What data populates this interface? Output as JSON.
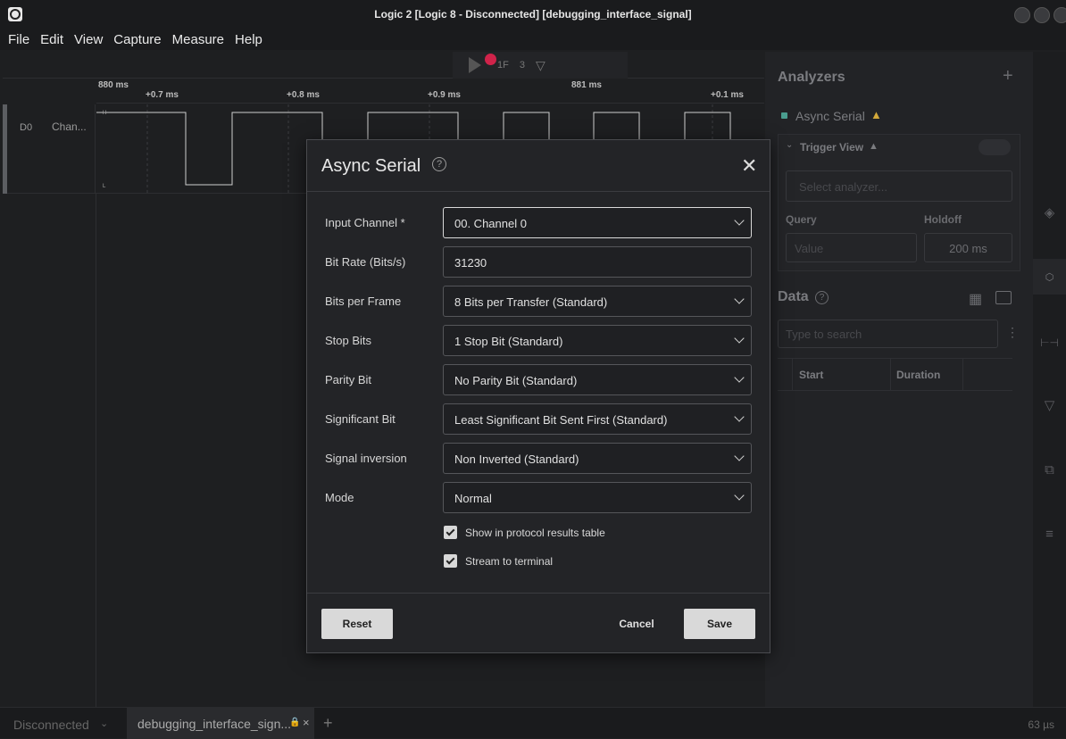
{
  "window": {
    "title": "Logic 2 [Logic 8 - Disconnected] [debugging_interface_signal]"
  },
  "menu": [
    "File",
    "Edit",
    "View",
    "Capture",
    "Measure",
    "Help"
  ],
  "toolbar": {
    "trigger_label": "1F",
    "measure_label": "3"
  },
  "ruler": {
    "left_label": "880 ms",
    "ticks": [
      "+0.7 ms",
      "+0.8 ms",
      "+0.9 ms",
      "881 ms",
      "+0.1 ms"
    ]
  },
  "channel": {
    "id": "D0",
    "name": "Chan...",
    "high": "H",
    "low": "L"
  },
  "side": {
    "analyzers_title": "Analyzers",
    "add_label": "+",
    "analyzer_item": "Async Serial",
    "trigger_view_label": "Trigger View",
    "select_analyzer_placeholder": "Select analyzer...",
    "query_label": "Query",
    "holdoff_label": "Holdoff",
    "value_placeholder": "Value",
    "holdoff_value": "200 ms",
    "data_title": "Data",
    "search_placeholder": "Type to search",
    "columns": [
      "Start",
      "Duration"
    ]
  },
  "modal": {
    "title": "Async Serial",
    "fields": [
      {
        "label": "Input Channel *",
        "value": "00.  Channel 0",
        "type": "select"
      },
      {
        "label": "Bit Rate (Bits/s)",
        "value": "31230",
        "type": "input"
      },
      {
        "label": "Bits per Frame",
        "value": "8 Bits per Transfer (Standard)",
        "type": "select"
      },
      {
        "label": "Stop Bits",
        "value": "1 Stop Bit (Standard)",
        "type": "select"
      },
      {
        "label": "Parity Bit",
        "value": "No Parity Bit (Standard)",
        "type": "select"
      },
      {
        "label": "Significant Bit",
        "value": "Least Significant Bit Sent First (Standard)",
        "type": "select"
      },
      {
        "label": "Signal inversion",
        "value": "Non Inverted (Standard)",
        "type": "select"
      },
      {
        "label": "Mode",
        "value": "Normal",
        "type": "select"
      }
    ],
    "checkboxes": [
      {
        "label": "Show in protocol results table",
        "checked": true
      },
      {
        "label": "Stream to terminal",
        "checked": true
      }
    ],
    "buttons": {
      "reset": "Reset",
      "cancel": "Cancel",
      "save": "Save"
    }
  },
  "status": {
    "connection": "Disconnected",
    "tab_label": "debugging_interface_sign...",
    "close_glyph": "×",
    "add_tab": "+",
    "time": "63 µs"
  },
  "colors": {
    "record": "#d0234a",
    "analyzer_dot": "#4a9d8f",
    "warning": "#d3a93a"
  }
}
